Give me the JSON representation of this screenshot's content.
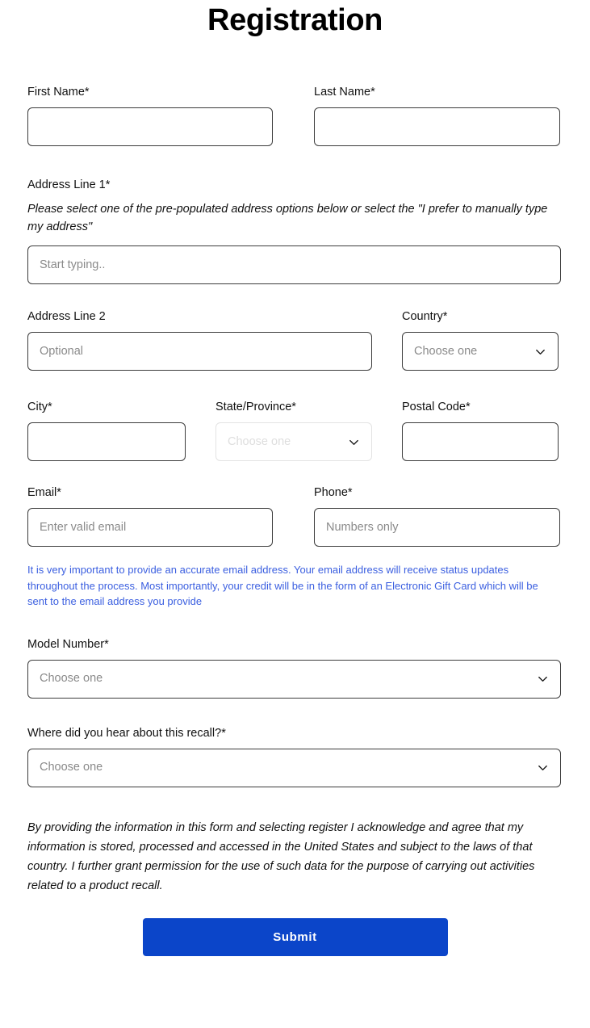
{
  "page": {
    "title": "Registration"
  },
  "form": {
    "required_marker": "*",
    "first_name": {
      "label": "First Name*",
      "value": "",
      "placeholder": ""
    },
    "last_name": {
      "label": "Last Name*",
      "value": "",
      "placeholder": ""
    },
    "address_line_1": {
      "label": "Address Line 1*",
      "hint": "Please select one of the pre-populated address options below or select the \"I prefer to manually type my address\"",
      "value": "",
      "placeholder": "Start typing.."
    },
    "address_line_2": {
      "label": "Address Line 2",
      "value": "",
      "placeholder": "Optional"
    },
    "country": {
      "label": "Country*",
      "selected": "Choose one",
      "icon": "chevron-down-icon",
      "disabled": false
    },
    "city": {
      "label": "City*",
      "value": "",
      "placeholder": ""
    },
    "state_province": {
      "label": "State/Province*",
      "selected": "Choose one",
      "icon": "chevron-down-icon",
      "disabled": true
    },
    "postal_code": {
      "label": "Postal Code*",
      "value": "",
      "placeholder": ""
    },
    "email": {
      "label": "Email*",
      "value": "",
      "placeholder": "Enter valid email"
    },
    "phone": {
      "label": "Phone*",
      "value": "",
      "placeholder": "Numbers only"
    },
    "email_note": "It is very important to provide an accurate email address. Your email address will receive status updates throughout the process. Most importantly, your credit will be in the form of an Electronic Gift Card which will be sent to the email address you provide",
    "model_number": {
      "label": "Model Number*",
      "selected": "Choose one",
      "icon": "chevron-down-icon",
      "disabled": false
    },
    "recall_source": {
      "label": "Where did you hear about this recall?*",
      "selected": "Choose one",
      "icon": "chevron-down-icon",
      "disabled": false
    },
    "disclaimer": "By providing the information in this form and selecting register I acknowledge and agree that my information is stored, processed and accessed in the United States and subject to the laws of that country. I further grant permission for the use of such data for the purpose of carrying out activities related to a product recall.",
    "submit": {
      "label": "Submit"
    }
  },
  "colors": {
    "submit_background": "#0b45c9",
    "submit_text": "#ffffff",
    "email_note_text": "#3b5fe0",
    "input_border": "#3c3c3c",
    "input_border_disabled": "#e3e3e3",
    "placeholder_text": "#8a8a8a",
    "body_text": "#111111",
    "page_background": "#ffffff"
  }
}
